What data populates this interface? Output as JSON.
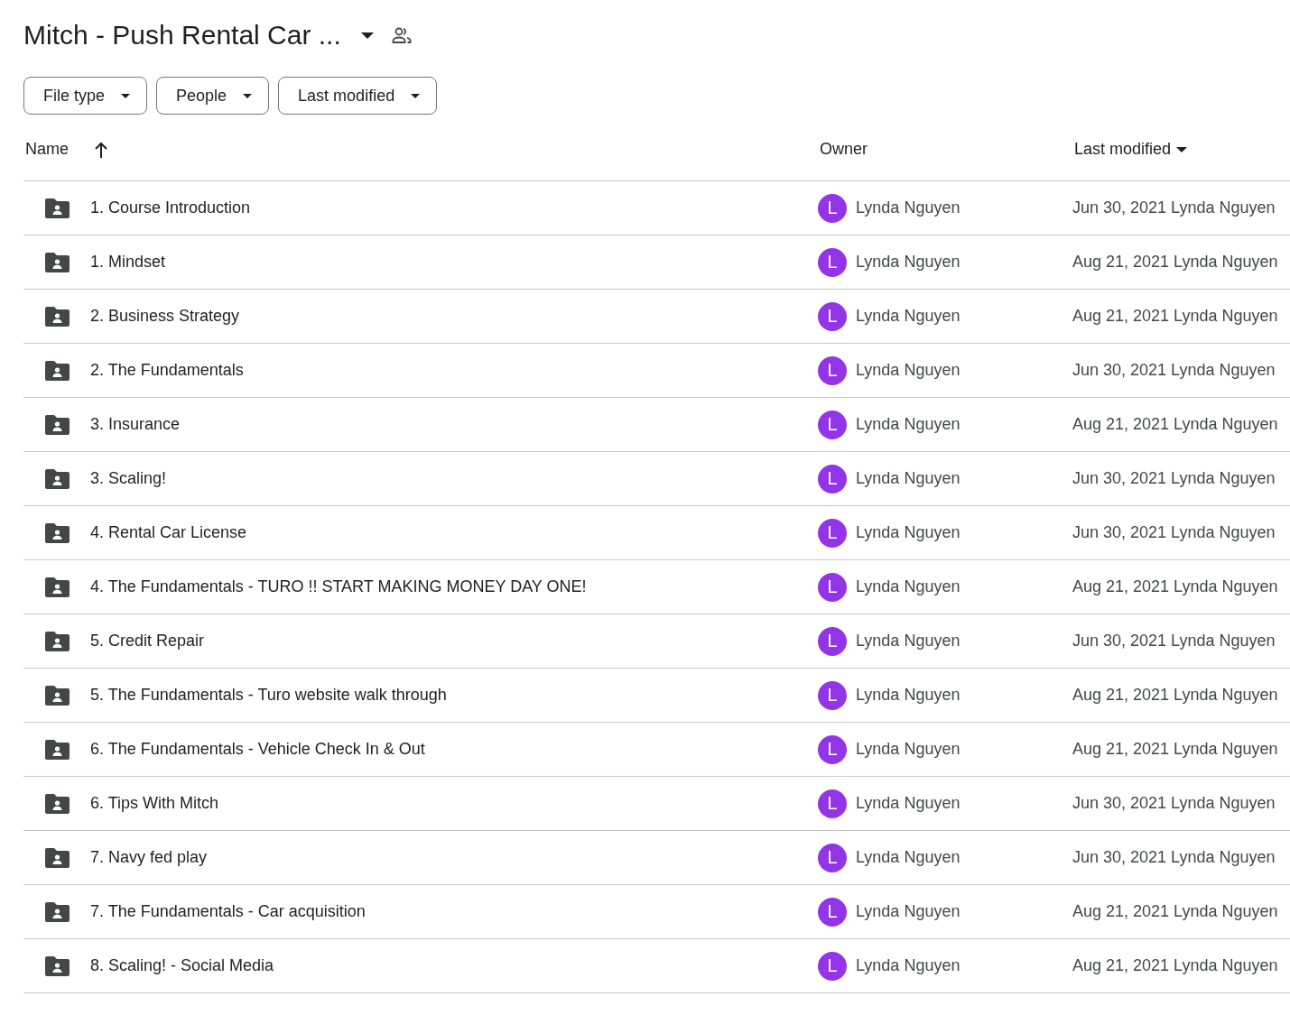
{
  "folder_title": "Mitch - Push Rental Car ...",
  "filters": [
    {
      "label": "File type"
    },
    {
      "label": "People"
    },
    {
      "label": "Last modified"
    }
  ],
  "columns": [
    {
      "label": "Name",
      "sorted_ascending": true,
      "sorted_descending": false
    },
    {
      "label": "Owner",
      "sorted_ascending": false,
      "sorted_descending": false
    },
    {
      "label": "Last modified",
      "sorted_ascending": false,
      "sorted_descending": true
    }
  ],
  "rows": [
    {
      "name": "1. Course Introduction",
      "owner": "Lynda Nguyen",
      "avatar": "L",
      "color": "#9334e6",
      "modified": "Jun 30, 2021 Lynda Nguyen"
    },
    {
      "name": "1. Mindset",
      "owner": "Lynda Nguyen",
      "avatar": "L",
      "color": "#9334e6",
      "modified": "Aug 21, 2021 Lynda Nguyen"
    },
    {
      "name": "2. Business Strategy",
      "owner": "Lynda Nguyen",
      "avatar": "L",
      "color": "#9334e6",
      "modified": "Aug 21, 2021 Lynda Nguyen"
    },
    {
      "name": "2. The Fundamentals",
      "owner": "Lynda Nguyen",
      "avatar": "L",
      "color": "#9334e6",
      "modified": "Jun 30, 2021 Lynda Nguyen"
    },
    {
      "name": "3. Insurance",
      "owner": "Lynda Nguyen",
      "avatar": "L",
      "color": "#9334e6",
      "modified": "Aug 21, 2021 Lynda Nguyen"
    },
    {
      "name": "3. Scaling!",
      "owner": "Lynda Nguyen",
      "avatar": "L",
      "color": "#9334e6",
      "modified": "Jun 30, 2021 Lynda Nguyen"
    },
    {
      "name": "4. Rental Car License",
      "owner": "Lynda Nguyen",
      "avatar": "L",
      "color": "#9334e6",
      "modified": "Jun 30, 2021 Lynda Nguyen"
    },
    {
      "name": "4. The Fundamentals - TURO !! START MAKING MONEY DAY ONE!",
      "owner": "Lynda Nguyen",
      "avatar": "L",
      "color": "#9334e6",
      "modified": "Aug 21, 2021 Lynda Nguyen"
    },
    {
      "name": "5. Credit Repair",
      "owner": "Lynda Nguyen",
      "avatar": "L",
      "color": "#9334e6",
      "modified": "Jun 30, 2021 Lynda Nguyen"
    },
    {
      "name": "5. The Fundamentals - Turo website walk through",
      "owner": "Lynda Nguyen",
      "avatar": "L",
      "color": "#9334e6",
      "modified": "Aug 21, 2021 Lynda Nguyen"
    },
    {
      "name": "6. The Fundamentals - Vehicle Check In & Out",
      "owner": "Lynda Nguyen",
      "avatar": "L",
      "color": "#9334e6",
      "modified": "Aug 21, 2021 Lynda Nguyen"
    },
    {
      "name": "6. Tips With Mitch",
      "owner": "Lynda Nguyen",
      "avatar": "L",
      "color": "#9334e6",
      "modified": "Jun 30, 2021 Lynda Nguyen"
    },
    {
      "name": "7. Navy fed play",
      "owner": "Lynda Nguyen",
      "avatar": "L",
      "color": "#9334e6",
      "modified": "Jun 30, 2021 Lynda Nguyen"
    },
    {
      "name": "7. The Fundamentals - Car acquisition",
      "owner": "Lynda Nguyen",
      "avatar": "L",
      "color": "#9334e6",
      "modified": "Aug 21, 2021 Lynda Nguyen"
    },
    {
      "name": "8. Scaling! - Social Media",
      "owner": "Lynda Nguyen",
      "avatar": "L",
      "color": "#9334e6",
      "modified": "Aug 21, 2021 Lynda Nguyen"
    }
  ]
}
